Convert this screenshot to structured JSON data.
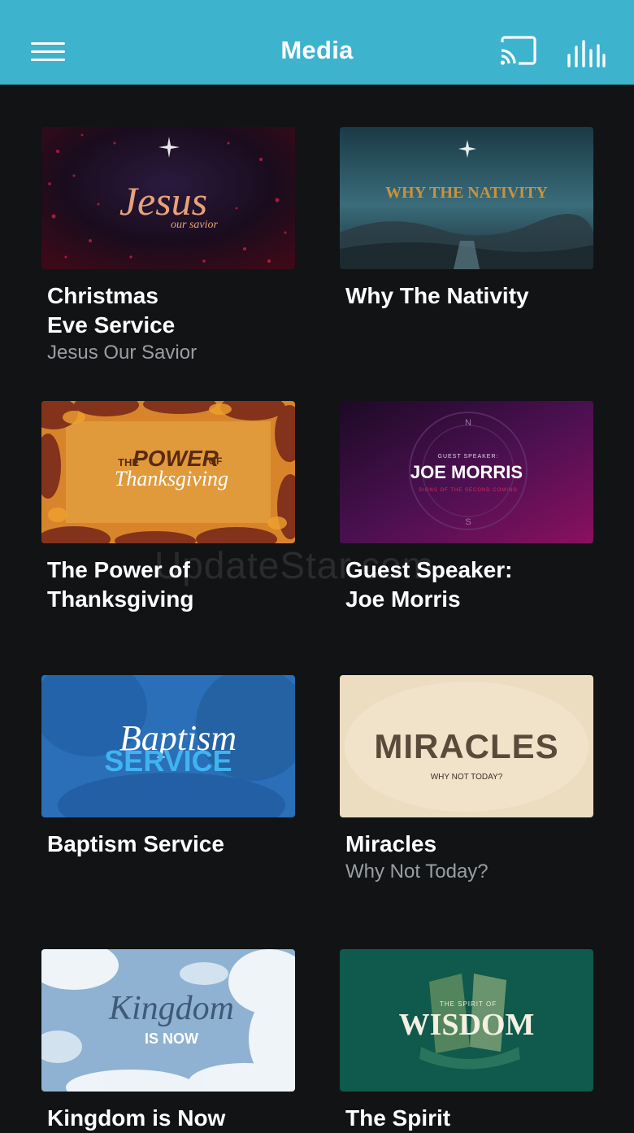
{
  "header": {
    "title": "Media",
    "background": "#3db3ce"
  },
  "watermark": "UpdateStar.com",
  "items": [
    {
      "title": "Christmas\nEve Service",
      "subtitle": "Jesus Our Savior",
      "art": {
        "line1": "Jesus",
        "line2": "our savior"
      }
    },
    {
      "title": "Why The Nativity",
      "subtitle": "",
      "art": {
        "line1": "WHY THE NATIVITY"
      }
    },
    {
      "title": "The Power of\nThanksgiving",
      "subtitle": "",
      "art": {
        "line1": "THE",
        "line2": "POWER",
        "line3": "OF",
        "line4": "Thanksgiving"
      }
    },
    {
      "title": "Guest Speaker:\nJoe Morris",
      "subtitle": "",
      "art": {
        "line1": "GUEST SPEAKER:",
        "line2": "JOE MORRIS",
        "line3": "SIGNS OF THE SECOND COMING"
      }
    },
    {
      "title": "Baptism Service",
      "subtitle": "",
      "art": {
        "line1": "Baptism",
        "line2": "SERVICE"
      }
    },
    {
      "title": "Miracles",
      "subtitle": "Why Not Today?",
      "art": {
        "line1": "MIRACLES",
        "line2": "WHY NOT TODAY?"
      }
    },
    {
      "title": "Kingdom is Now",
      "subtitle": "",
      "art": {
        "line1": "Kingdom",
        "line2": "IS NOW"
      }
    },
    {
      "title": "The Spirit",
      "subtitle": "",
      "art": {
        "line1": "THE SPIRIT OF",
        "line2": "WISDOM"
      }
    }
  ]
}
